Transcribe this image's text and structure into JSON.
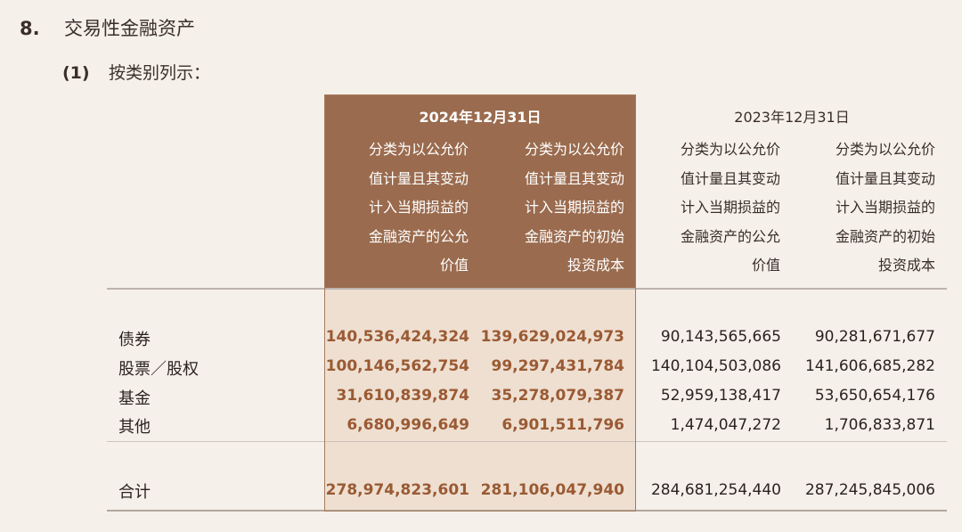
{
  "section": {
    "number": "8.",
    "title": "交易性金融资产"
  },
  "subsection": {
    "number": "(1)",
    "title": "按类别列示："
  },
  "table": {
    "period_current": "2024年12月31日",
    "period_previous": "2023年12月31日",
    "column_headers": [
      [
        "分类为以公允价",
        "值计量且其变动",
        "计入当期损益的",
        "金融资产的公允",
        "价值"
      ],
      [
        "分类为以公允价",
        "值计量且其变动",
        "计入当期损益的",
        "金融资产的初始",
        "投资成本"
      ],
      [
        "分类为以公允价",
        "值计量且其变动",
        "计入当期损益的",
        "金融资产的公允",
        "价值"
      ],
      [
        "分类为以公允价",
        "值计量且其变动",
        "计入当期损益的",
        "金融资产的初始",
        "投资成本"
      ]
    ],
    "rows": [
      {
        "label": "债券",
        "values": [
          "140,536,424,324",
          "139,629,024,973",
          "90,143,565,665",
          "90,281,671,677"
        ]
      },
      {
        "label": "股票／股权",
        "values": [
          "100,146,562,754",
          "99,297,431,784",
          "140,104,503,086",
          "141,606,685,282"
        ]
      },
      {
        "label": "基金",
        "values": [
          "31,610,839,874",
          "35,278,079,387",
          "52,959,138,417",
          "53,650,654,176"
        ]
      },
      {
        "label": "其他",
        "values": [
          "6,680,996,649",
          "6,901,511,796",
          "1,474,047,272",
          "1,706,833,871"
        ]
      }
    ],
    "total": {
      "label": "合计",
      "values": [
        "278,974,823,601",
        "281,106,047,940",
        "284,681,254,440",
        "287,245,845,006"
      ]
    }
  },
  "colors": {
    "highlight_header": "#9a6b4e",
    "highlight_body": "#eedfd1",
    "highlight_text": "#9a5a33",
    "page_background": "#f6f0ea"
  }
}
